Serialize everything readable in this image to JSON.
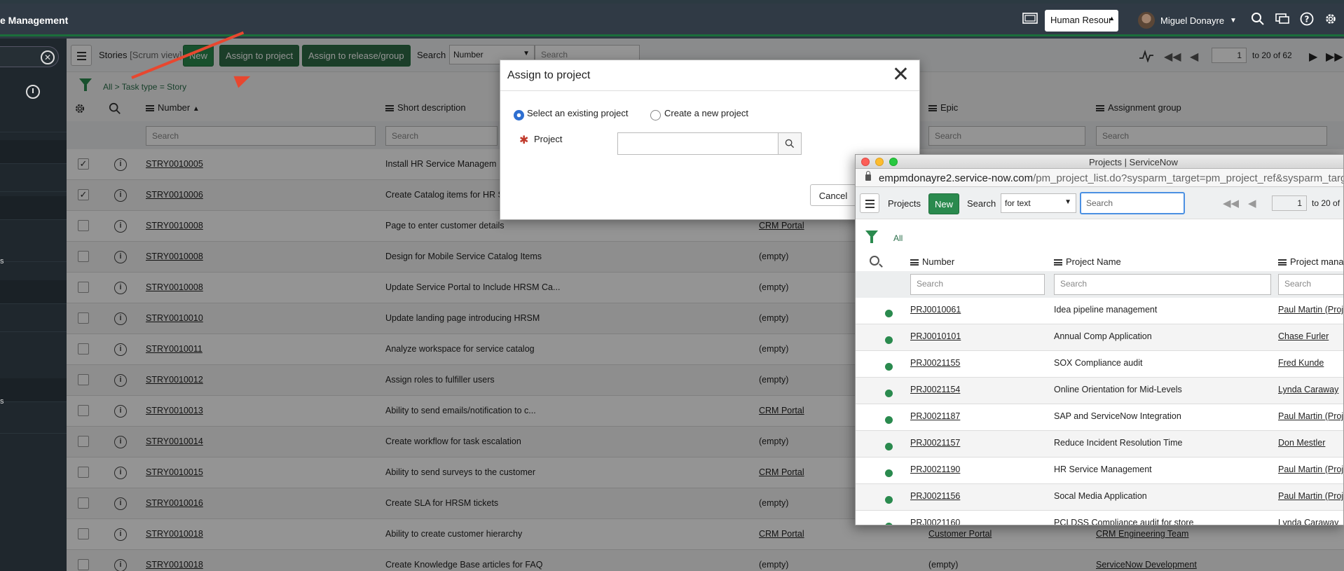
{
  "header": {
    "brand": "e Management",
    "domain_select": "Human Resour",
    "user_name": "Miguel Donayre"
  },
  "toolbar": {
    "list_title": "Stories",
    "list_view": "[Scrum view]",
    "new_label": "New",
    "assign_project_label": "Assign to project",
    "assign_release_label": "Assign to release/group",
    "search_label": "Search",
    "search_field": "Number",
    "search_placeholder": "Search",
    "page_number": "1",
    "page_range": "to 20 of 62"
  },
  "breadcrumb": "All > Task type = Story",
  "columns": {
    "number": "Number",
    "short_description": "Short description",
    "epic": "Epic",
    "assignment_group": "Assignment group",
    "filter_placeholder": "Search"
  },
  "rows": [
    {
      "checked": true,
      "number": "STRY0010005",
      "desc": "Install HR Service Managem",
      "epic": "",
      "group": ""
    },
    {
      "checked": true,
      "number": "STRY0010006",
      "desc": "Create Catalog items for HR Se",
      "epic": "",
      "group": ""
    },
    {
      "checked": false,
      "number": "STRY0010008",
      "desc": "Page to enter customer details",
      "epic": "CRM Portal",
      "group": ""
    },
    {
      "checked": false,
      "number": "STRY0010008",
      "desc": "Design for Mobile Service Catalog Items",
      "epic": "(empty)",
      "group": ""
    },
    {
      "checked": false,
      "number": "STRY0010008",
      "desc": "Update Service Portal to Include HRSM Ca...",
      "epic": "(empty)",
      "group": ""
    },
    {
      "checked": false,
      "number": "STRY0010010",
      "desc": "Update landing page introducing HRSM",
      "epic": "(empty)",
      "group": ""
    },
    {
      "checked": false,
      "number": "STRY0010011",
      "desc": "Analyze workspace for service catalog",
      "epic": "(empty)",
      "group": ""
    },
    {
      "checked": false,
      "number": "STRY0010012",
      "desc": "Assign roles to fulfiller users",
      "epic": "(empty)",
      "group": ""
    },
    {
      "checked": false,
      "number": "STRY0010013",
      "desc": "Ability to send emails/notification to c...",
      "epic": "CRM Portal",
      "group": ""
    },
    {
      "checked": false,
      "number": "STRY0010014",
      "desc": "Create workflow for task escalation",
      "epic": "(empty)",
      "group": ""
    },
    {
      "checked": false,
      "number": "STRY0010015",
      "desc": "Ability to send surveys to the customer",
      "epic": "CRM Portal",
      "group": ""
    },
    {
      "checked": false,
      "number": "STRY0010016",
      "desc": "Create SLA for HRSM tickets",
      "epic": "(empty)",
      "group": ""
    },
    {
      "checked": false,
      "number": "STRY0010018",
      "desc": "Ability to create customer hierarchy",
      "epic": "CRM Portal",
      "epic2": "Customer Portal",
      "group": "CRM Engineering Team"
    },
    {
      "checked": false,
      "number": "STRY0010018",
      "desc": "Create Knowledge Base articles for FAQ",
      "epic": "(empty)",
      "epic2": "(empty)",
      "group": "ServiceNow Development"
    }
  ],
  "modal": {
    "title": "Assign to project",
    "option_existing": "Select an existing project",
    "option_new": "Create a new project",
    "project_label": "Project",
    "cancel_label": "Cancel"
  },
  "popup": {
    "window_title": "Projects | ServiceNow",
    "url_host": "empmdonayre2.service-now.com",
    "url_path": "/pm_project_list.do?sysparm_target=pm_project_ref&sysparm_targe",
    "list_title": "Projects",
    "new_label": "New",
    "search_label": "Search",
    "search_field": "for text",
    "search_placeholder": "Search",
    "page_number": "1",
    "page_range": "to 20 of",
    "breadcrumb": "All",
    "col_number": "Number",
    "col_name": "Project Name",
    "col_manager": "Project manag",
    "filter_placeholder": "Search",
    "rows": [
      {
        "number": "PRJ0010061",
        "name": "Idea pipeline management",
        "manager": "Paul Martin (Proje"
      },
      {
        "number": "PRJ0010101",
        "name": "Annual Comp Application",
        "manager": "Chase Furler"
      },
      {
        "number": "PRJ0021155",
        "name": "SOX Compliance audit",
        "manager": "Fred Kunde"
      },
      {
        "number": "PRJ0021154",
        "name": "Online Orientation for Mid-Levels",
        "manager": "Lynda Caraway"
      },
      {
        "number": "PRJ0021187",
        "name": "SAP and ServiceNow Integration",
        "manager": "Paul Martin (Proje"
      },
      {
        "number": "PRJ0021157",
        "name": "Reduce Incident Resolution Time",
        "manager": "Don Mestler"
      },
      {
        "number": "PRJ0021190",
        "name": "HR Service Management",
        "manager": "Paul Martin (Proje"
      },
      {
        "number": "PRJ0021156",
        "name": "Socal Media Application",
        "manager": "Paul Martin (Proje"
      },
      {
        "number": "PRJ0021160",
        "name": "PCI DSS Compliance audit for store",
        "manager": "Lynda Caraway"
      }
    ]
  },
  "colors": {
    "accent_green": "#2a8a4e",
    "header_bg": "#303a45",
    "annotation_arrow": "#e8472f",
    "focus_blue": "#4b90e2"
  }
}
